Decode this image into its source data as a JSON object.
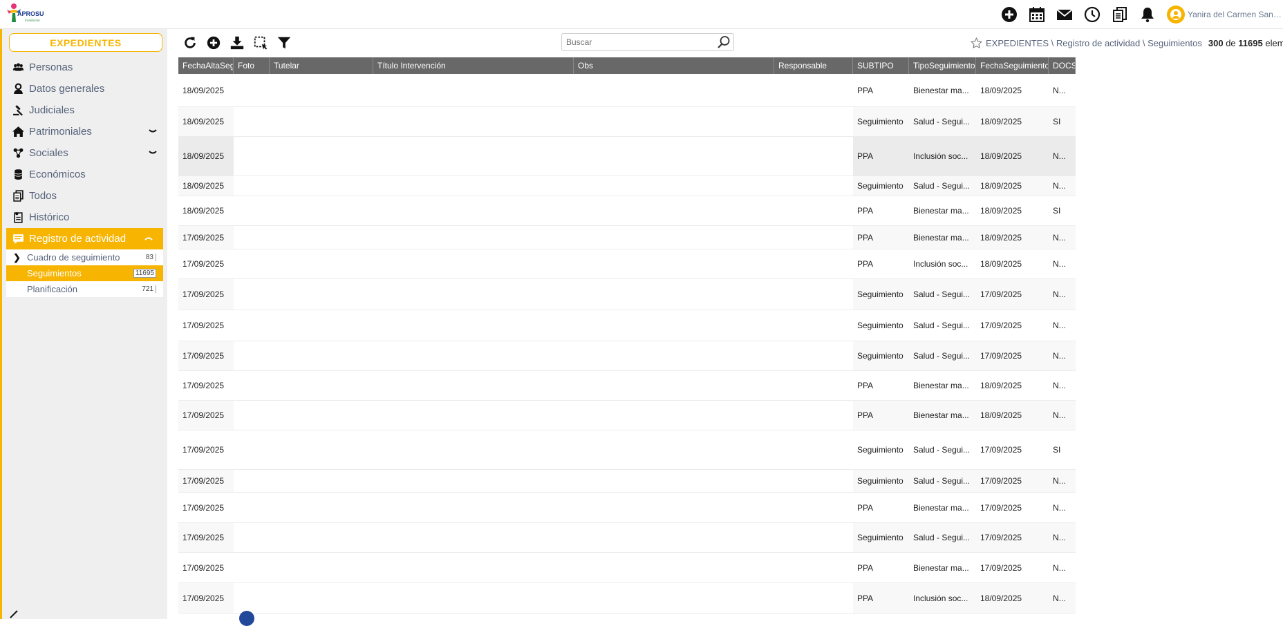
{
  "app": {
    "logo_text": "APROSU",
    "logo_subtext": "Fundación"
  },
  "topbar": {
    "icons": [
      "plus-circle-icon",
      "calendar-icon",
      "mail-icon",
      "clock-icon",
      "documents-icon",
      "bell-icon"
    ],
    "user_name": "Yanira del Carmen Santana ..."
  },
  "sidebar": {
    "expedientes_label": "EXPEDIENTES",
    "items": [
      {
        "label": "Personas",
        "icon": "people-icon",
        "chevron": false
      },
      {
        "label": "Datos generales",
        "icon": "person-icon",
        "chevron": false
      },
      {
        "label": "Judiciales",
        "icon": "gavel-icon",
        "chevron": false
      },
      {
        "label": "Patrimoniales",
        "icon": "home-icon",
        "chevron": true
      },
      {
        "label": "Sociales",
        "icon": "network-icon",
        "chevron": true
      },
      {
        "label": "Económicos",
        "icon": "coins-icon",
        "chevron": false
      },
      {
        "label": "Todos",
        "icon": "documents-icon",
        "chevron": false
      },
      {
        "label": "Histórico",
        "icon": "history-icon",
        "chevron": false
      },
      {
        "label": "Registro de actividad",
        "icon": "comment-icon",
        "chevron": true
      }
    ],
    "subitems": [
      {
        "label": "Cuadro de seguimiento",
        "count": "83"
      },
      {
        "label": "Seguimientos",
        "count": "11695"
      },
      {
        "label": "Planificación",
        "count": "721"
      }
    ]
  },
  "toolbar": {
    "icons": [
      "refresh-icon",
      "add-circle-icon",
      "download-icon",
      "select-area-icon",
      "filter-icon"
    ],
    "search_placeholder": "Buscar"
  },
  "breadcrumb": {
    "path": "EXPEDIENTES \\ Registro de actividad \\ Seguimientos",
    "shown": "300",
    "de": "de",
    "total": "11695",
    "suffix": "elementos"
  },
  "grid": {
    "headers": [
      "FechaAltaSeg",
      "Foto",
      "Tutelar",
      "Título Intervención",
      "Obs",
      "Responsable",
      "SUBTIPO",
      "TipoSeguimiento",
      "FechaSeguimiento",
      "DOCS"
    ],
    "rows": [
      {
        "fecha_alta": "18/09/2025",
        "subtipo": "PPA",
        "tipo": "Bienestar ma...",
        "fecha_seg": "18/09/2025",
        "docs": "N..."
      },
      {
        "fecha_alta": "18/09/2025",
        "subtipo": "Seguimiento",
        "tipo": "Salud - Segui...",
        "fecha_seg": "18/09/2025",
        "docs": "SI"
      },
      {
        "fecha_alta": "18/09/2025",
        "subtipo": "PPA",
        "tipo": "Inclusión soc...",
        "fecha_seg": "18/09/2025",
        "docs": "N..."
      },
      {
        "fecha_alta": "18/09/2025",
        "subtipo": "Seguimiento",
        "tipo": "Salud - Segui...",
        "fecha_seg": "18/09/2025",
        "docs": "N..."
      },
      {
        "fecha_alta": "18/09/2025",
        "subtipo": "PPA",
        "tipo": "Bienestar ma...",
        "fecha_seg": "18/09/2025",
        "docs": "SI"
      },
      {
        "fecha_alta": "17/09/2025",
        "subtipo": "PPA",
        "tipo": "Bienestar ma...",
        "fecha_seg": "18/09/2025",
        "docs": "N..."
      },
      {
        "fecha_alta": "17/09/2025",
        "subtipo": "PPA",
        "tipo": "Inclusión soc...",
        "fecha_seg": "18/09/2025",
        "docs": "N..."
      },
      {
        "fecha_alta": "17/09/2025",
        "subtipo": "Seguimiento",
        "tipo": "Salud - Segui...",
        "fecha_seg": "17/09/2025",
        "docs": "N..."
      },
      {
        "fecha_alta": "17/09/2025",
        "subtipo": "Seguimiento",
        "tipo": "Salud - Segui...",
        "fecha_seg": "17/09/2025",
        "docs": "N..."
      },
      {
        "fecha_alta": "17/09/2025",
        "subtipo": "Seguimiento",
        "tipo": "Salud - Segui...",
        "fecha_seg": "17/09/2025",
        "docs": "N..."
      },
      {
        "fecha_alta": "17/09/2025",
        "subtipo": "PPA",
        "tipo": "Bienestar ma...",
        "fecha_seg": "18/09/2025",
        "docs": "N..."
      },
      {
        "fecha_alta": "17/09/2025",
        "subtipo": "PPA",
        "tipo": "Bienestar ma...",
        "fecha_seg": "18/09/2025",
        "docs": "N..."
      },
      {
        "fecha_alta": "17/09/2025",
        "subtipo": "Seguimiento",
        "tipo": "Salud - Segui...",
        "fecha_seg": "17/09/2025",
        "docs": "SI"
      },
      {
        "fecha_alta": "17/09/2025",
        "subtipo": "Seguimiento",
        "tipo": "Salud - Segui...",
        "fecha_seg": "17/09/2025",
        "docs": "N..."
      },
      {
        "fecha_alta": "17/09/2025",
        "subtipo": "PPA",
        "tipo": "Bienestar ma...",
        "fecha_seg": "17/09/2025",
        "docs": "N..."
      },
      {
        "fecha_alta": "17/09/2025",
        "subtipo": "Seguimiento",
        "tipo": "Salud - Segui...",
        "fecha_seg": "17/09/2025",
        "docs": "N..."
      },
      {
        "fecha_alta": "17/09/2025",
        "subtipo": "PPA",
        "tipo": "Bienestar ma...",
        "fecha_seg": "17/09/2025",
        "docs": "N..."
      },
      {
        "fecha_alta": "17/09/2025",
        "subtipo": "PPA",
        "tipo": "Inclusión soc...",
        "fecha_seg": "18/09/2025",
        "docs": "N..."
      }
    ]
  },
  "colors": {
    "accent": "#f7b400",
    "header_bg": "#686868",
    "nav_text": "#55627a"
  }
}
